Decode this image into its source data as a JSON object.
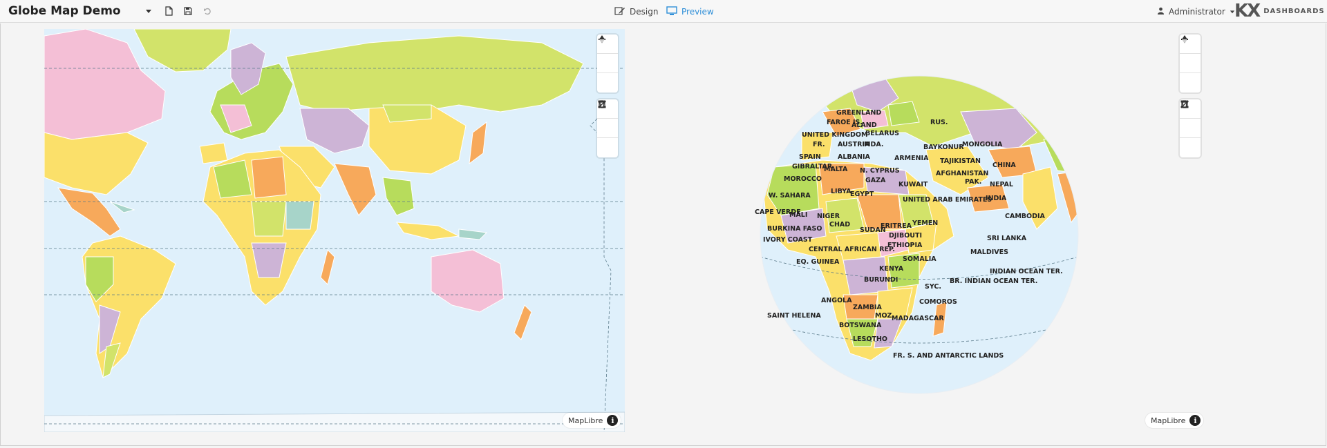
{
  "toolbar": {
    "app_title": "Globe Map Demo",
    "design_label": "Design",
    "preview_label": "Preview",
    "user_label": "Administrator",
    "brand_mark": "KX",
    "brand_text": "DASHBOARDS",
    "icons": [
      "dropdown-caret-icon",
      "new-file-icon",
      "save-icon",
      "undo-icon",
      "pencil-icon",
      "monitor-icon",
      "user-icon"
    ],
    "active_mode": "Preview",
    "accent_color": "#2f8fd8"
  },
  "flat_map": {
    "attribution": "MapLibre",
    "controls": [
      "zoom-in",
      "zoom-out",
      "reset-north",
      "draw-line",
      "draw-polygon",
      "trash"
    ]
  },
  "globe_map": {
    "attribution": "MapLibre",
    "controls": [
      "zoom-in",
      "zoom-out",
      "reset-north",
      "draw-line",
      "draw-polygon",
      "trash"
    ],
    "labels": [
      "GREENLAND",
      "FAROE IS.",
      "ALAND",
      "RUS.",
      "UNITED KINGDOM",
      "BELARUS",
      "MONGOLIA",
      "FR.",
      "AUSTRIA",
      "MDA.",
      "BAYKONUR",
      "SPAIN",
      "ALBANIA",
      "ARMENIA",
      "TAJIKISTAN",
      "CHINA",
      "GIBRALTAR",
      "MALTA",
      "N. CYPRUS",
      "AFGHANISTAN",
      "MOROCCO",
      "GAZA",
      "PAK.",
      "NEPAL",
      "LIBYA",
      "KUWAIT",
      "W. SAHARA",
      "EGYPT",
      "INDIA",
      "UNITED ARAB EMIRATES",
      "CAPE VERDE",
      "MALI",
      "NIGER",
      "CAMBODIA",
      "CHAD",
      "ERITREA",
      "YEMEN",
      "BURKINA FASO",
      "SUDAN",
      "DJIBOUTI",
      "SRI LANKA",
      "IVORY COAST",
      "ETHIOPIA",
      "CENTRAL AFRICAN REP.",
      "MALDIVES",
      "SOMALIA",
      "EQ. GUINEA",
      "KENYA",
      "INDIAN OCEAN TER.",
      "BURUNDI",
      "BR. INDIAN OCEAN TER.",
      "SYC.",
      "ANGOLA",
      "COMOROS",
      "ZAMBIA",
      "SAINT HELENA",
      "MOZ.",
      "MADAGASCAR",
      "BOTSWANA",
      "LESOTHO",
      "FR. S. AND ANTARCTIC LANDS"
    ]
  },
  "colors": {
    "ocean": "#dff0fb",
    "land_green": "#d2e36a",
    "land_yellow": "#fbe06a",
    "land_orange": "#f7a95b",
    "land_pink": "#f4bfd6",
    "land_purple": "#cdb4d6",
    "land_teal": "#a7d4c9",
    "land_lime": "#b7dc5c"
  }
}
